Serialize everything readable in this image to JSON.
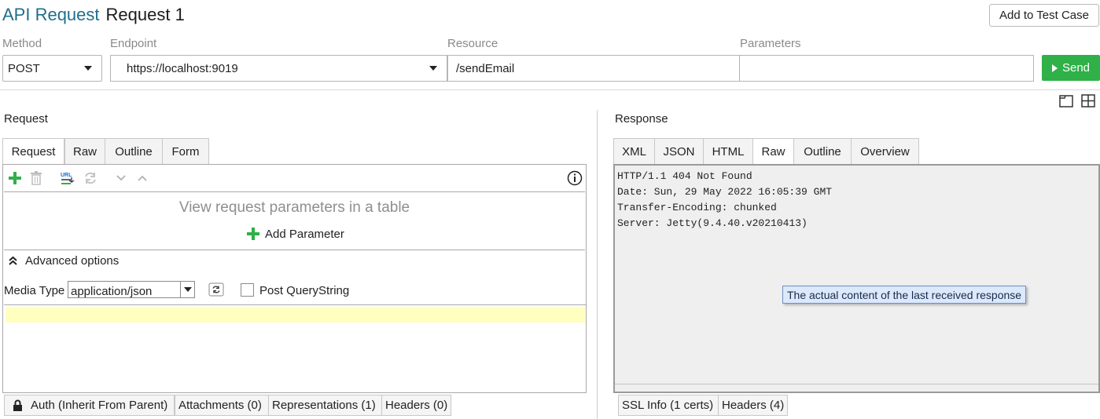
{
  "header": {
    "type_label": "API Request",
    "name": "Request 1",
    "add_to_test_case": "Add to Test Case"
  },
  "method": {
    "label": "Method",
    "value": "POST"
  },
  "endpoint": {
    "label": "Endpoint",
    "value": "https://localhost:9019"
  },
  "resource": {
    "label": "Resource",
    "value": "/sendEmail"
  },
  "parameters": {
    "label": "Parameters",
    "value": ""
  },
  "send": {
    "label": "Send"
  },
  "request": {
    "section_label": "Request",
    "tabs": [
      "Request",
      "Raw",
      "Outline",
      "Form"
    ],
    "active_tab": "Request",
    "empty_text": "View request parameters in a table",
    "add_parameter": "Add Parameter",
    "advanced_options": "Advanced options",
    "media_type_label": "Media Type",
    "media_type_value": "application/json",
    "post_querystring": "Post QueryString",
    "bottom_tabs": [
      "Auth (Inherit From Parent)",
      "Attachments (0)",
      "Representations (1)",
      "Headers (0)"
    ]
  },
  "response": {
    "section_label": "Response",
    "tabs": [
      "XML",
      "JSON",
      "HTML",
      "Raw",
      "Outline",
      "Overview"
    ],
    "active_tab": "Raw",
    "lines": [
      "HTTP/1.1 404 Not Found",
      "Date: Sun, 29 May 2022 16:05:39 GMT",
      "Transfer-Encoding: chunked",
      "Server: Jetty(9.4.40.v20210413)"
    ],
    "tooltip": "The actual content of the last received response",
    "bottom_tabs": [
      "SSL Info (1 certs)",
      "Headers (4)"
    ]
  },
  "colors": {
    "accent": "#1f6f8b",
    "send": "#2fb048",
    "highlight": "#ffffc0",
    "tooltip_bg": "#dce9fb"
  }
}
